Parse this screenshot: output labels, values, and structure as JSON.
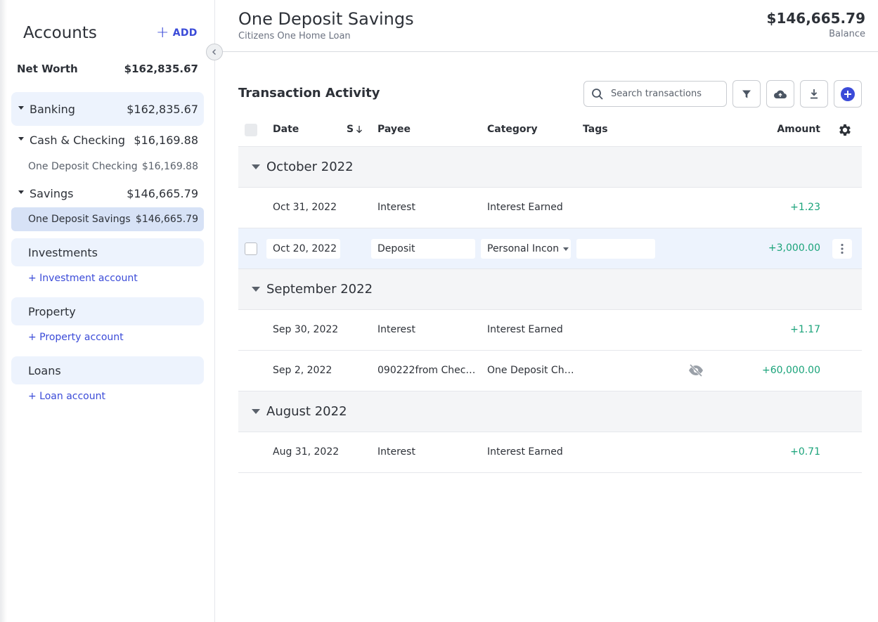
{
  "sidebar": {
    "title": "Accounts",
    "add_label": "ADD",
    "net_worth_label": "Net Worth",
    "net_worth_value": "$162,835.67",
    "banking": {
      "label": "Banking",
      "value": "$162,835.67"
    },
    "cash_checking": {
      "label": "Cash & Checking",
      "value": "$16,169.88"
    },
    "checking_account": {
      "label": "One Deposit Checking",
      "value": "$16,169.88"
    },
    "savings": {
      "label": "Savings",
      "value": "$146,665.79"
    },
    "savings_account": {
      "label": "One Deposit Savings",
      "value": "$146,665.79"
    },
    "investments": {
      "label": "Investments",
      "add": "+ Investment account"
    },
    "property": {
      "label": "Property",
      "add": "+ Property account"
    },
    "loans": {
      "label": "Loans",
      "add": "+ Loan account"
    }
  },
  "header": {
    "title": "One Deposit Savings",
    "subtitle": "Citizens One Home Loan",
    "balance": "$146,665.79",
    "balance_label": "Balance"
  },
  "activity": {
    "title": "Transaction Activity",
    "search_placeholder": "Search transactions"
  },
  "table": {
    "columns": {
      "date": "Date",
      "status": "S",
      "payee": "Payee",
      "category": "Category",
      "tags": "Tags",
      "amount": "Amount"
    },
    "groups": [
      {
        "month": "October 2022",
        "rows": [
          {
            "date": "Oct 31, 2022",
            "payee": "Interest",
            "category": "Interest Earned",
            "amount": "+1.23"
          },
          {
            "date": "Oct 20, 2022",
            "payee": "Deposit",
            "category": "Personal Incon",
            "amount": "+3,000.00"
          }
        ]
      },
      {
        "month": "September 2022",
        "rows": [
          {
            "date": "Sep 30, 2022",
            "payee": "Interest",
            "category": "Interest Earned",
            "amount": "+1.17"
          },
          {
            "date": "Sep 2, 2022",
            "payee": "090222from Chec…",
            "category": "One Deposit Ch…",
            "amount": "+60,000.00"
          }
        ]
      },
      {
        "month": "August 2022",
        "rows": [
          {
            "date": "Aug 31, 2022",
            "payee": "Interest",
            "category": "Interest Earned",
            "amount": "+0.71"
          }
        ]
      }
    ]
  },
  "colors": {
    "accent": "#3b4bd8",
    "positive": "#1aa37a",
    "selected": "#d7e2f6",
    "group_bg": "#edf3fd"
  }
}
